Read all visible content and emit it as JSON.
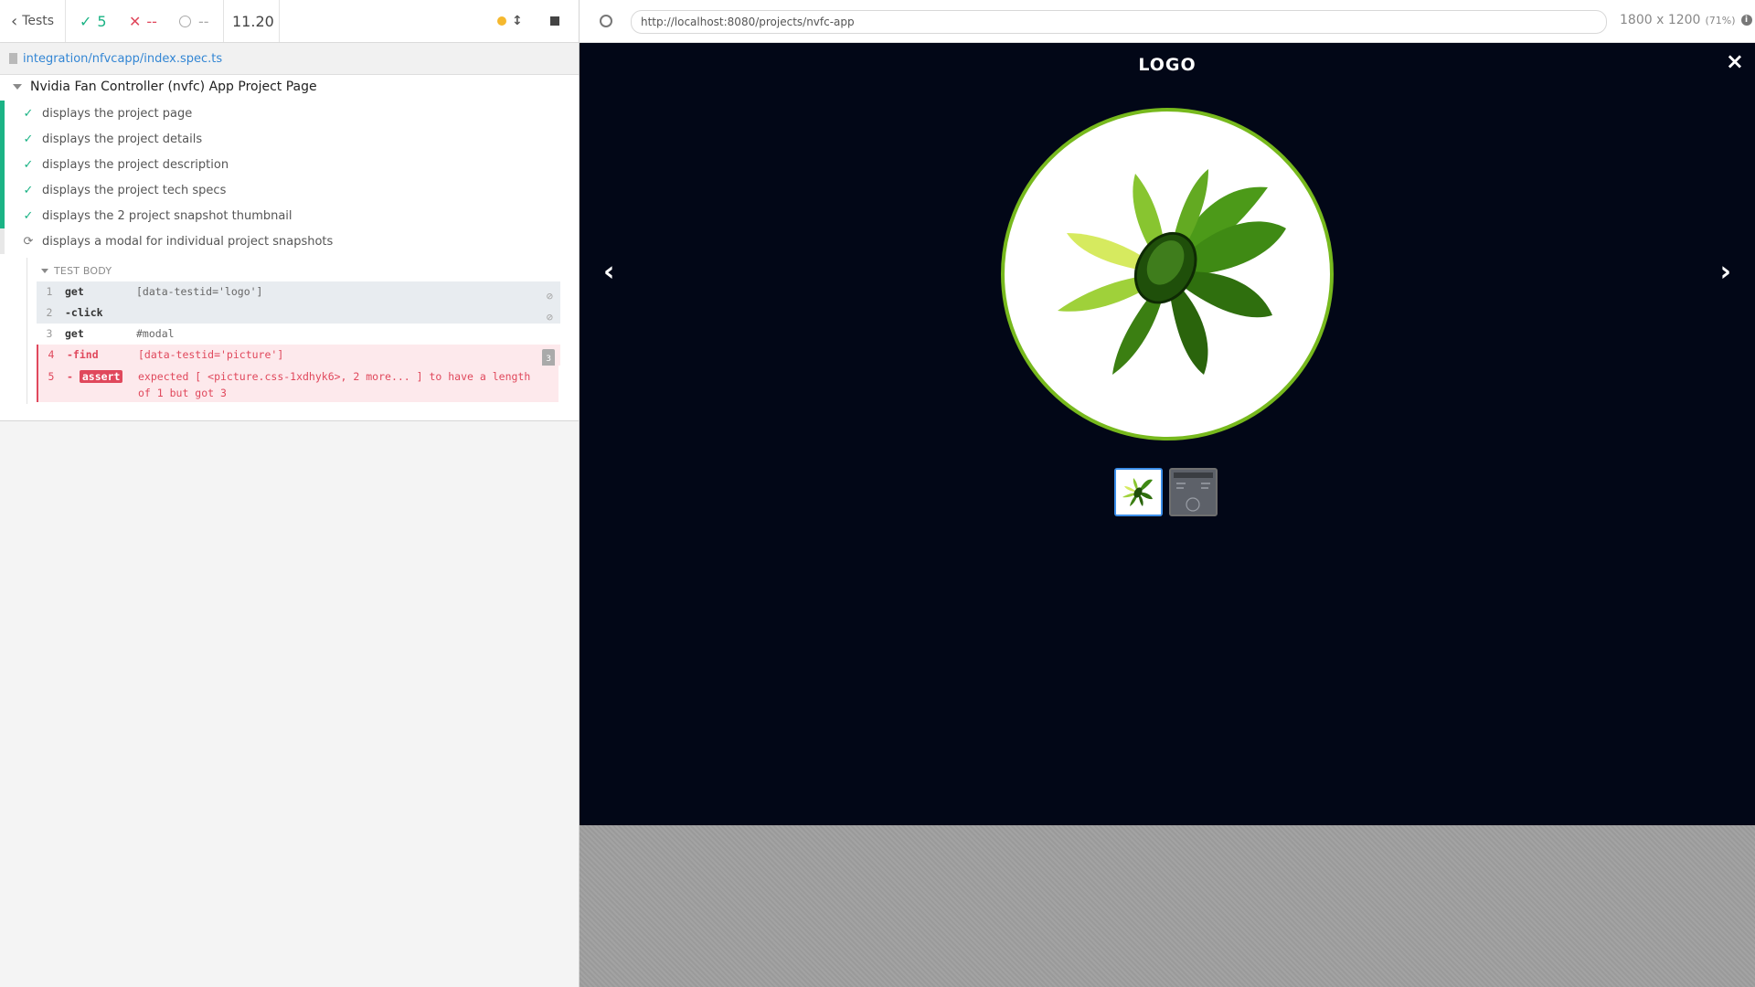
{
  "reporter": {
    "tests_label": "Tests",
    "passed": "5",
    "failed": "--",
    "pending": "--",
    "duration": "11.20",
    "spec_path": "integration/nfvcapp/index.spec.ts",
    "suite_title": "Nvidia Fan Controller (nvfc) App Project Page",
    "tests": [
      {
        "title": "displays the project page",
        "state": "passed"
      },
      {
        "title": "displays the project details",
        "state": "passed"
      },
      {
        "title": "displays the project description",
        "state": "passed"
      },
      {
        "title": "displays the project tech specs",
        "state": "passed"
      },
      {
        "title": "displays the 2 project snapshot thumbnail",
        "state": "passed"
      },
      {
        "title": "displays a modal for individual project snapshots",
        "state": "running"
      }
    ],
    "test_body_label": "TEST BODY",
    "commands": [
      {
        "num": "1",
        "name": "get",
        "message": "[data-testid='logo']"
      },
      {
        "num": "2",
        "name": "-click",
        "message": ""
      },
      {
        "num": "3",
        "name": "get",
        "message": "#modal"
      },
      {
        "num": "4",
        "name": "-find",
        "message": "[data-testid='picture']",
        "count": "3"
      },
      {
        "num": "5",
        "name": "-",
        "label": "assert",
        "message_line1": "expected [ <picture.css-1xdhyk6>, 2 more... ] to have a length",
        "message_line2": "of 1 but got 3"
      }
    ]
  },
  "aut": {
    "url": "http://localhost:8080/projects/nvfc-app",
    "viewport": "1800 x 1200",
    "scale": "(71%)",
    "modal_title": "LOGO",
    "close_glyph": "×",
    "prev_glyph": "‹",
    "next_glyph": "›"
  },
  "colors": {
    "pass": "#1bb385",
    "fail": "#e0485c",
    "link": "#3386d4",
    "modal_bg": "#020717",
    "accent_green": "#77b91d"
  }
}
